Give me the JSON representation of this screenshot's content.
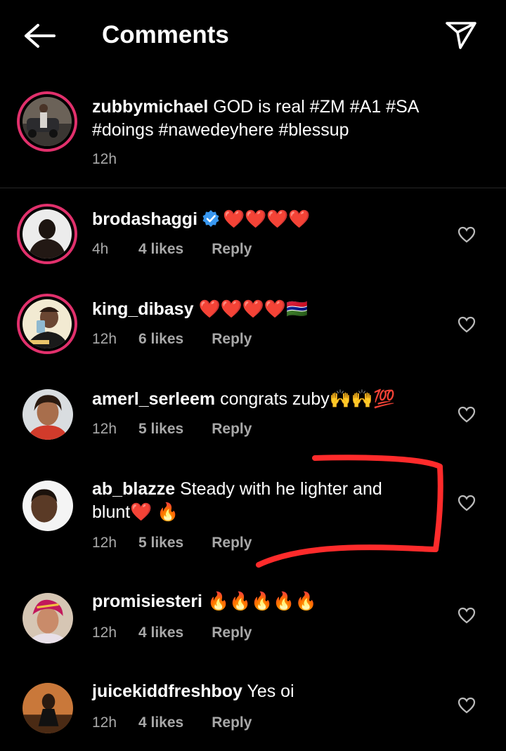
{
  "header": {
    "title": "Comments",
    "back_icon": "arrow-left-icon",
    "share_icon": "paper-plane-icon"
  },
  "caption": {
    "username": "zubbymichael",
    "text_line1": "GOD is real #ZM #A1 #SA",
    "text_line2": "#doings #nawedeyhere #blessup",
    "time": "12h"
  },
  "comments": [
    {
      "username": "brodashaggi",
      "verified": true,
      "text": "❤️❤️❤️❤️",
      "time": "4h",
      "likes": "4 likes",
      "reply": "Reply"
    },
    {
      "username": "king_dibasy",
      "verified": false,
      "text": "❤️❤️❤️❤️🇬🇲",
      "time": "12h",
      "likes": "6 likes",
      "reply": "Reply"
    },
    {
      "username": "amerl_serleem",
      "verified": false,
      "text": "congrats zuby🙌🙌💯",
      "time": "12h",
      "likes": "5 likes",
      "reply": "Reply"
    },
    {
      "username": "ab_blazze",
      "verified": false,
      "text_line1": "Steady with he lighter and",
      "text_line2": "blunt❤️ 🔥",
      "time": "12h",
      "likes": "5 likes",
      "reply": "Reply"
    },
    {
      "username": "promisiesteri",
      "verified": false,
      "text": "🔥🔥🔥🔥🔥",
      "time": "12h",
      "likes": "4 likes",
      "reply": "Reply"
    },
    {
      "username": "juicekiddfreshboy",
      "verified": false,
      "text": "Yes oi",
      "time": "12h",
      "likes": "4 likes",
      "reply": "Reply"
    }
  ],
  "colors": {
    "background": "#000000",
    "secondary_text": "#a8a8a8",
    "story_ring": "#e1306c",
    "verified_badge": "#3897f0",
    "annotation": "#ff2b2b"
  }
}
